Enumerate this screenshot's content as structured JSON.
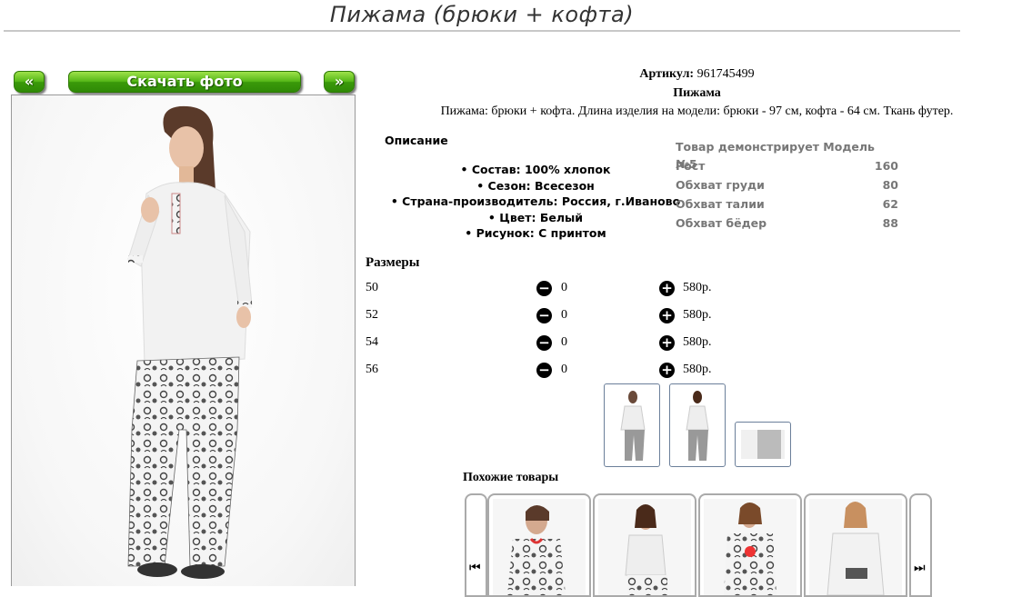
{
  "title": "Пижама (брюки + кофта)",
  "nav": {
    "prev_label": "«",
    "download_label": "Скачать фото",
    "next_label": "»"
  },
  "product": {
    "article_label": "Артикул:",
    "article_value": "961745499",
    "name": "Пижама",
    "description": "Пижама: брюки + кофта. Длина изделия на модели: брюки - 97 см, кофта - 64 см. Ткань футер."
  },
  "description_heading": "Описание",
  "properties": [
    "Состав: 100% хлопок",
    "Сезон: Всесезон",
    "Страна-производитель: Россия, г.Иваново",
    "Цвет: Белый",
    "Рисунок: С принтом"
  ],
  "model": {
    "heading": "Товар демонстрирует Модель №5",
    "rows": [
      {
        "label": "Рост",
        "value": "160"
      },
      {
        "label": "Обхват груди",
        "value": "80"
      },
      {
        "label": "Обхват талии",
        "value": "62"
      },
      {
        "label": "Обхват бёдер",
        "value": "88"
      }
    ]
  },
  "sizes_heading": "Размеры",
  "sizes": [
    {
      "size": "50",
      "qty": "0",
      "price": "580р."
    },
    {
      "size": "52",
      "qty": "0",
      "price": "580р."
    },
    {
      "size": "54",
      "qty": "0",
      "price": "580р."
    },
    {
      "size": "56",
      "qty": "0",
      "price": "580р."
    }
  ],
  "icons": {
    "decrease": "minus-circle-icon",
    "increase": "plus-circle-icon",
    "carousel_prev": "skip-back-icon",
    "carousel_next": "skip-forward-icon"
  },
  "similar_heading": "Похожие товары",
  "colors": {
    "button_green": "#56b818",
    "muted_text": "#777777",
    "frame_border": "#6b7f9a"
  }
}
